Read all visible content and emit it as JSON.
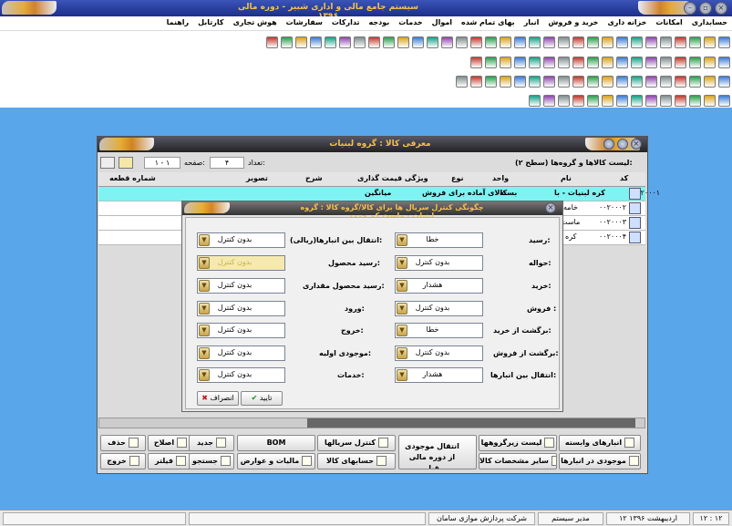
{
  "app": {
    "title": "سیستم جامع مالی و اداری شبیر - دوره مالی ۱۳۹۶"
  },
  "menu": [
    "حسابداری",
    "امکانات",
    "خزانه داری",
    "خرید و فروش",
    "انبار",
    "بهای تمام شده",
    "اموال",
    "خدمات",
    "بودجه",
    "تدارکات",
    "سفارشات",
    "هوش تجاری",
    "کارتابل",
    "راهنما"
  ],
  "window": {
    "title": "معرفی کالا : گروه لبنیات",
    "list_title": "لیست کالاها و گروه‌ها (سطح ۲):",
    "count_label": "تعداد:",
    "count_value": "۴",
    "page_label": "صفحه:",
    "page_value": "۱ - ۱",
    "columns": [
      "کد",
      "نام",
      "واحد",
      "نوع",
      "ویژگی قیمت گذاری",
      "شرح",
      "تصویر",
      "شماره قطعه"
    ],
    "rows": [
      {
        "code": "۰۰۲۰۰۰۱",
        "name": "کره لبنیات - با",
        "unit": "بسته",
        "type": "کالای آماده برای فروش",
        "pricing": "میانگین"
      },
      {
        "code": "۰۰۲۰۰۰۲",
        "name": "خامه",
        "unit": "",
        "type": "",
        "pricing": ""
      },
      {
        "code": "۰۰۲۰۰۰۳",
        "name": "ماست مو",
        "unit": "",
        "type": "",
        "pricing": ""
      },
      {
        "code": "۰۰۲۰۰۰۴",
        "name": "کره",
        "unit": "",
        "type": "",
        "pricing": ""
      }
    ]
  },
  "dialog": {
    "title": "چگونگی کنترل سریال ها برای کالا/گروه کالا : گروه لبنیات - ماست کم چرب",
    "right": [
      {
        "label": "رسید:",
        "value": "خطا"
      },
      {
        "label": "حواله:",
        "value": "بدون کنترل"
      },
      {
        "label": "خرید:",
        "value": "هشدار"
      },
      {
        "label": "فروش :",
        "value": "بدون کنترل"
      },
      {
        "label": "برگشت از خرید:",
        "value": "خطا"
      },
      {
        "label": "برگشت از فروش:",
        "value": "بدون کنترل"
      },
      {
        "label": "انتقال بین انبارها:",
        "value": "هشدار"
      }
    ],
    "left": [
      {
        "label": "انتقال بین انبارها(ریالی):",
        "value": "بدون کنترل"
      },
      {
        "label": "رسید محصول:",
        "value": "بدون کنترل"
      },
      {
        "label": "رسید محصول مقداری:",
        "value": "بدون کنترل"
      },
      {
        "label": "ورود:",
        "value": "بدون کنترل"
      },
      {
        "label": "خروج:",
        "value": "بدون کنترل"
      },
      {
        "label": "موجودی اولیه:",
        "value": "بدون کنترل"
      },
      {
        "label": "خدمات:",
        "value": "بدون کنترل"
      }
    ],
    "ok": "تایید",
    "cancel": "انصراف"
  },
  "buttons": {
    "new": "جدید",
    "edit": "اصلاح",
    "delete": "حذف",
    "search": "جستجو",
    "filter": "فیلتر",
    "exit": "خروج",
    "bom": "BOM",
    "serials": "کنترل سریالها",
    "goods_accounts": "حسابهای کالا",
    "taxes": "مالیات و عوارض",
    "transfer": "انتقال موجودی از دوره مالی قبل",
    "subgroups": "لیست زیرگروهها",
    "other_specs": "سایر مشخصات کالا",
    "related_whs": "انبارهای وابسته",
    "stock_in_whs": "موجودی در انبارها"
  },
  "status": {
    "time": "۱۲ : ۱۲",
    "date": "۱۲ اردیبهشت ۱۳۹۶",
    "user": "مدیر سیستم",
    "company": "شرکت پردازش موازی سامان"
  }
}
